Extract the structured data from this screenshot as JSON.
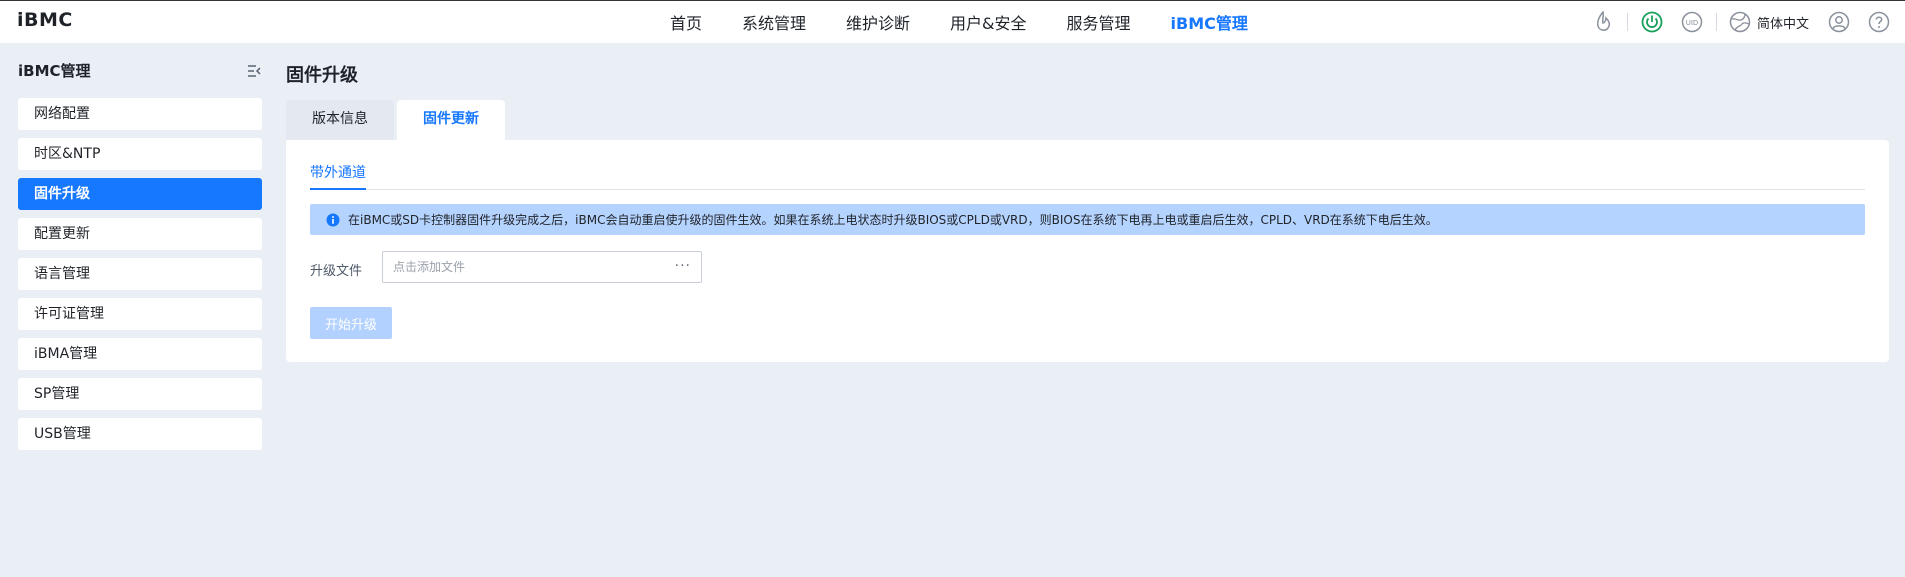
{
  "app": {
    "logo": "iBMC"
  },
  "nav": {
    "items": [
      {
        "label": "首页"
      },
      {
        "label": "系统管理"
      },
      {
        "label": "维护诊断"
      },
      {
        "label": "用户&安全"
      },
      {
        "label": "服务管理"
      },
      {
        "label": "iBMC管理"
      }
    ],
    "active_index": 5
  },
  "toolbar": {
    "language": "简体中文",
    "icons": [
      "energy-icon",
      "power-icon",
      "uid-icon",
      "globe-icon",
      "user-icon",
      "help-icon"
    ],
    "power_color": "#18a058",
    "uid_label": "UID"
  },
  "sidebar": {
    "title": "iBMC管理",
    "items": [
      {
        "label": "网络配置"
      },
      {
        "label": "时区&NTP"
      },
      {
        "label": "固件升级"
      },
      {
        "label": "配置更新"
      },
      {
        "label": "语言管理"
      },
      {
        "label": "许可证管理"
      },
      {
        "label": "iBMA管理"
      },
      {
        "label": "SP管理"
      },
      {
        "label": "USB管理"
      }
    ],
    "active_index": 2
  },
  "main": {
    "title": "固件升级",
    "tabs": [
      {
        "label": "版本信息"
      },
      {
        "label": "固件更新"
      }
    ],
    "active_tab": 1,
    "subtab": "带外通道",
    "alert": "在iBMC或SD卡控制器固件升级完成之后，iBMC会自动重启使升级的固件生效。如果在系统上电状态时升级BIOS或CPLD或VRD，则BIOS在系统下电再上电或重启后生效，CPLD、VRD在系统下电后生效。",
    "upload": {
      "label": "升级文件",
      "placeholder": "点击添加文件",
      "value": "",
      "browse": "···"
    },
    "start_button": "开始升级"
  },
  "colors": {
    "accent": "#1677ff",
    "alert_bg": "#b5d3ff",
    "disabled_button": "#b3d1ff",
    "page_bg": "#eaeef5"
  }
}
